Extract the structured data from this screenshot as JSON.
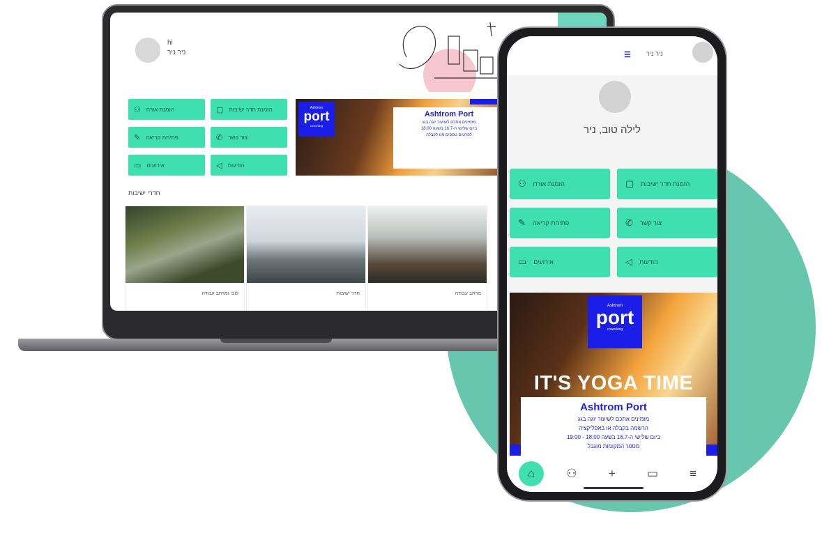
{
  "colors": {
    "accent_green": "#3fe0b0",
    "background_circle": "#66c6ae",
    "brand_blue": "#1a1ee8"
  },
  "laptop": {
    "user": {
      "greeting": "hi",
      "name": "ניר ניר"
    },
    "buttons": [
      {
        "label": "הזמנת אורח",
        "icon": "user-plus-icon"
      },
      {
        "label": "הזמנת חדר ישיבות",
        "icon": "calendar-icon"
      },
      {
        "label": "פתיחת קריאה",
        "icon": "wrench-icon"
      },
      {
        "label": "צור קשר",
        "icon": "phone-icon"
      },
      {
        "label": "אירועים",
        "icon": "tv-icon"
      },
      {
        "label": "הודעות",
        "icon": "megaphone-icon"
      }
    ],
    "banner": {
      "logo_small": "Ashtrom",
      "logo_big": "port",
      "logo_tiny": "coworking",
      "card_title": "Ashtrom Port",
      "card_line1": "מזמינים אתכם לשיעור יוגה בגג",
      "card_line2": "ביום שלישי ה-16.7 בשעה 18:00",
      "card_line3": "לפרטים נוספים פנו לקבלה"
    },
    "section_title": "חדרי ישיבות",
    "photos": [
      {
        "caption": "לובי ומרחב עבודה"
      },
      {
        "caption": "חדר ישיבות"
      },
      {
        "caption": "מרחב עבודה"
      }
    ]
  },
  "phone": {
    "top_flag": "☰",
    "top_name": "ניר ניר",
    "greeting": "לילה טוב, ניר",
    "buttons": [
      {
        "label": "הזמנת אורח",
        "icon": "user-plus-icon"
      },
      {
        "label": "הזמנת חדר ישיבות",
        "icon": "calendar-icon"
      },
      {
        "label": "פתיחת קריאה",
        "icon": "wrench-icon"
      },
      {
        "label": "צור קשר",
        "icon": "phone-icon"
      },
      {
        "label": "אירועים",
        "icon": "tv-icon"
      },
      {
        "label": "הודעות",
        "icon": "megaphone-icon"
      }
    ],
    "banner": {
      "logo_small": "Ashtrom",
      "logo_big": "port",
      "logo_tiny": "coworking",
      "headline": "IT'S YOGA TIME",
      "card_title": "Ashtrom Port",
      "card_line1": "מזמינים אתכם לשיעור יוגה בגג",
      "card_line2": "הרשמה בקבלה או באפליקציה",
      "card_line3": "ביום שלישי ה-16.7 בשעה 18:00 - 19:00",
      "card_line4": "מספר המקומות מוגבל"
    },
    "nav": [
      {
        "icon": "home-icon",
        "glyph": "⌂"
      },
      {
        "icon": "user-plus-icon",
        "glyph": "⚇"
      },
      {
        "icon": "plus-icon",
        "glyph": "+"
      },
      {
        "icon": "chat-icon",
        "glyph": "▭"
      },
      {
        "icon": "menu-icon",
        "glyph": "≡"
      }
    ]
  }
}
